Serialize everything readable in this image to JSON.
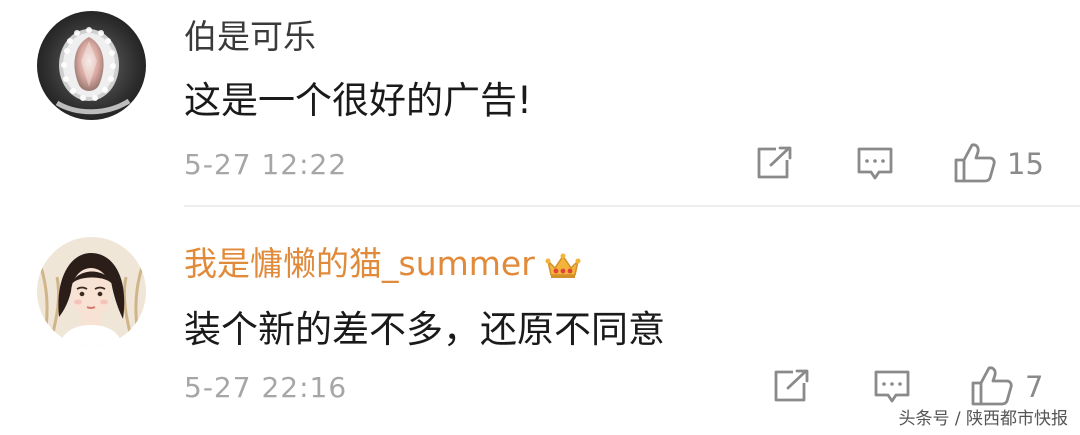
{
  "comments": [
    {
      "username": "伯是可乐",
      "text": "这是一个很好的广告!",
      "time": "5-27 12:22",
      "likes": "15",
      "avatar_icon": "diamond-ring-photo"
    },
    {
      "username": "我是慵懒的猫_summer",
      "text": "装个新的差不多，还原不同意",
      "time": "5-27 22:16",
      "likes": "7",
      "avatar_icon": "cartoon-girl-illustration",
      "badge_icon": "crown-icon",
      "username_color": "#e08a3a"
    }
  ],
  "watermark": "头条号 / 陕西都市快报"
}
